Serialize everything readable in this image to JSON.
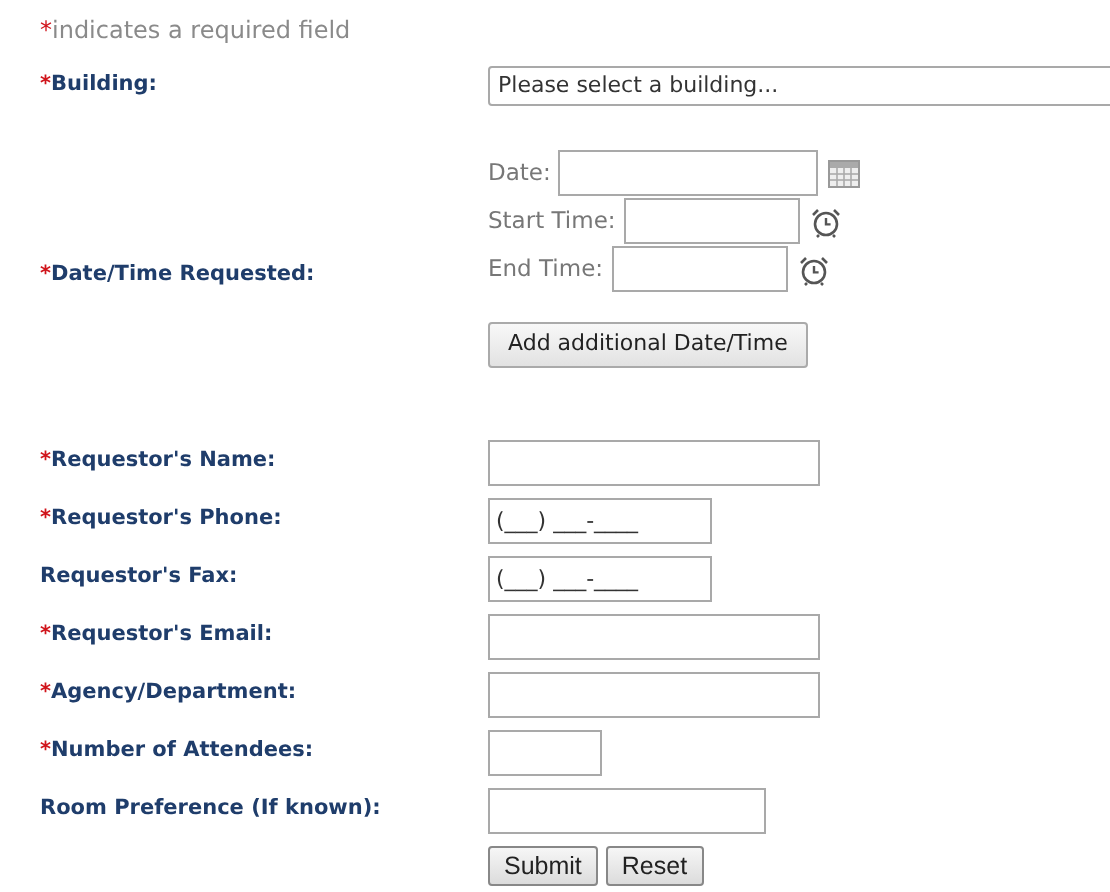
{
  "note": {
    "marker": "*",
    "text": "indicates a required field"
  },
  "building": {
    "marker": "*",
    "label": "Building:",
    "placeholder": "Please select a building..."
  },
  "datetime": {
    "marker": "*",
    "label": "Date/Time Requested:",
    "fields": [
      {
        "label": "Date:",
        "kind": "date"
      },
      {
        "label": "Start Time:",
        "kind": "time"
      },
      {
        "label": "End Time:",
        "kind": "time"
      }
    ],
    "add_button": "Add additional Date/Time"
  },
  "fields": [
    {
      "marker": "*",
      "label": "Requestor's Name:"
    },
    {
      "marker": "*",
      "label": "Requestor's Phone:",
      "value": "(___) ___-____"
    },
    {
      "label": "Requestor's Fax:",
      "value": "(___) ___-____"
    },
    {
      "marker": "*",
      "label": "Requestor's Email:"
    },
    {
      "marker": "*",
      "label": "Agency/Department:"
    },
    {
      "marker": "*",
      "label": "Number of Attendees:"
    },
    {
      "label": "Room Preference (If known):"
    }
  ],
  "buttons": [
    "Submit",
    "Reset"
  ]
}
